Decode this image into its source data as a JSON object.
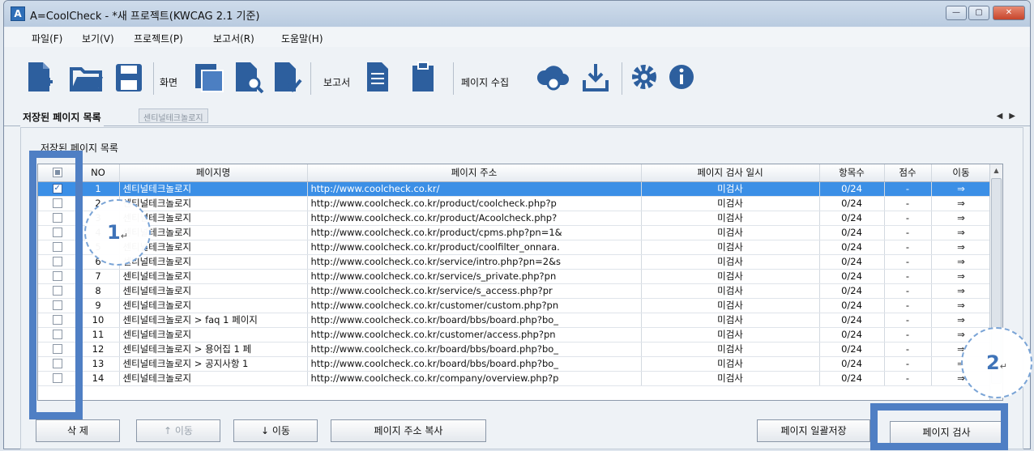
{
  "window": {
    "title": "A=CoolCheck - *새 프로젝트(KWCAG 2.1 기준)",
    "controls": {
      "minimize": "—",
      "maximize": "▢",
      "close": "✕"
    }
  },
  "menu": [
    "파일(F)",
    "보기(V)",
    "프로젝트(P)",
    "보고서(R)",
    "도움말(H)"
  ],
  "toolbar": {
    "screen_label": "화면",
    "report_label": "보고서",
    "collect_label": "페이지 수집",
    "icons": [
      "new-file-icon",
      "open-folder-icon",
      "save-icon",
      "screen-copy-icon",
      "screen-search-icon",
      "screen-check-icon",
      "report-doc-icon",
      "report-clipboard-icon",
      "cloud-collect-icon",
      "download-collect-icon",
      "gear-icon",
      "info-icon"
    ]
  },
  "tabs": {
    "active": "저장된 페이지 목록",
    "inactive": "센티널테크놀로지"
  },
  "section_title": "저장된 페이지 목록",
  "table": {
    "headers": [
      "",
      "NO",
      "페이지명",
      "페이지 주소",
      "페이지 검사 일시",
      "항목수",
      "점수",
      "이동"
    ],
    "rows": [
      {
        "checked": true,
        "no": "1",
        "name": "센티널테크놀로지",
        "url": "http://www.coolcheck.co.kr/",
        "date": "미검사",
        "count": "0/24",
        "score": "-",
        "move": "⇒"
      },
      {
        "checked": false,
        "no": "2",
        "name": "센티널테크놀로지",
        "url": "http://www.coolcheck.co.kr/product/coolcheck.php?p",
        "date": "미검사",
        "count": "0/24",
        "score": "-",
        "move": "⇒"
      },
      {
        "checked": false,
        "no": "3",
        "name": "센티널테크놀로지",
        "url": "http://www.coolcheck.co.kr/product/Acoolcheck.php?",
        "date": "미검사",
        "count": "0/24",
        "score": "-",
        "move": "⇒"
      },
      {
        "checked": false,
        "no": "4",
        "name": "센티널테크놀로지",
        "url": "http://www.coolcheck.co.kr/product/cpms.php?pn=1&",
        "date": "미검사",
        "count": "0/24",
        "score": "-",
        "move": "⇒"
      },
      {
        "checked": false,
        "no": "5",
        "name": "센티널테크놀로지",
        "url": "http://www.coolcheck.co.kr/product/coolfilter_onnara.",
        "date": "미검사",
        "count": "0/24",
        "score": "-",
        "move": "⇒"
      },
      {
        "checked": false,
        "no": "6",
        "name": "센티널테크놀로지",
        "url": "http://www.coolcheck.co.kr/service/intro.php?pn=2&s",
        "date": "미검사",
        "count": "0/24",
        "score": "-",
        "move": "⇒"
      },
      {
        "checked": false,
        "no": "7",
        "name": "센티널테크놀로지",
        "url": "http://www.coolcheck.co.kr/service/s_private.php?pn",
        "date": "미검사",
        "count": "0/24",
        "score": "-",
        "move": "⇒"
      },
      {
        "checked": false,
        "no": "8",
        "name": "센티널테크놀로지",
        "url": "http://www.coolcheck.co.kr/service/s_access.php?pr",
        "date": "미검사",
        "count": "0/24",
        "score": "-",
        "move": "⇒"
      },
      {
        "checked": false,
        "no": "9",
        "name": "센티널테크놀로지",
        "url": "http://www.coolcheck.co.kr/customer/custom.php?pn",
        "date": "미검사",
        "count": "0/24",
        "score": "-",
        "move": "⇒"
      },
      {
        "checked": false,
        "no": "10",
        "name": "센티널테크놀로지 > faq 1 페이지",
        "url": "http://www.coolcheck.co.kr/board/bbs/board.php?bo_",
        "date": "미검사",
        "count": "0/24",
        "score": "-",
        "move": "⇒"
      },
      {
        "checked": false,
        "no": "11",
        "name": "센티널테크놀로지",
        "url": "http://www.coolcheck.co.kr/customer/access.php?pn",
        "date": "미검사",
        "count": "0/24",
        "score": "-",
        "move": "⇒"
      },
      {
        "checked": false,
        "no": "12",
        "name": "센티널테크놀로지 > 용어집 1 페",
        "url": "http://www.coolcheck.co.kr/board/bbs/board.php?bo_",
        "date": "미검사",
        "count": "0/24",
        "score": "-",
        "move": "⇒"
      },
      {
        "checked": false,
        "no": "13",
        "name": "센티널테크놀로지 > 공지사항 1",
        "url": "http://www.coolcheck.co.kr/board/bbs/board.php?bo_",
        "date": "미검사",
        "count": "0/24",
        "score": "-",
        "move": "⇒"
      },
      {
        "checked": false,
        "no": "14",
        "name": "센티널테크놀로지",
        "url": "http://www.coolcheck.co.kr/company/overview.php?p",
        "date": "미검사",
        "count": "0/24",
        "score": "-",
        "move": "⇒"
      }
    ]
  },
  "buttons": {
    "delete": "삭 제",
    "move_up": "↑ 이동",
    "move_down": "↓ 이동",
    "copy_url": "페이지 주소 복사",
    "save_all": "페이지 일괄저장",
    "inspect": "페이지 검사"
  },
  "callouts": {
    "one": "1",
    "two": "2",
    "return_mark": "↵"
  },
  "colors": {
    "highlight_box": "#4f7fc4",
    "selected_row": "#3b8fe6"
  }
}
